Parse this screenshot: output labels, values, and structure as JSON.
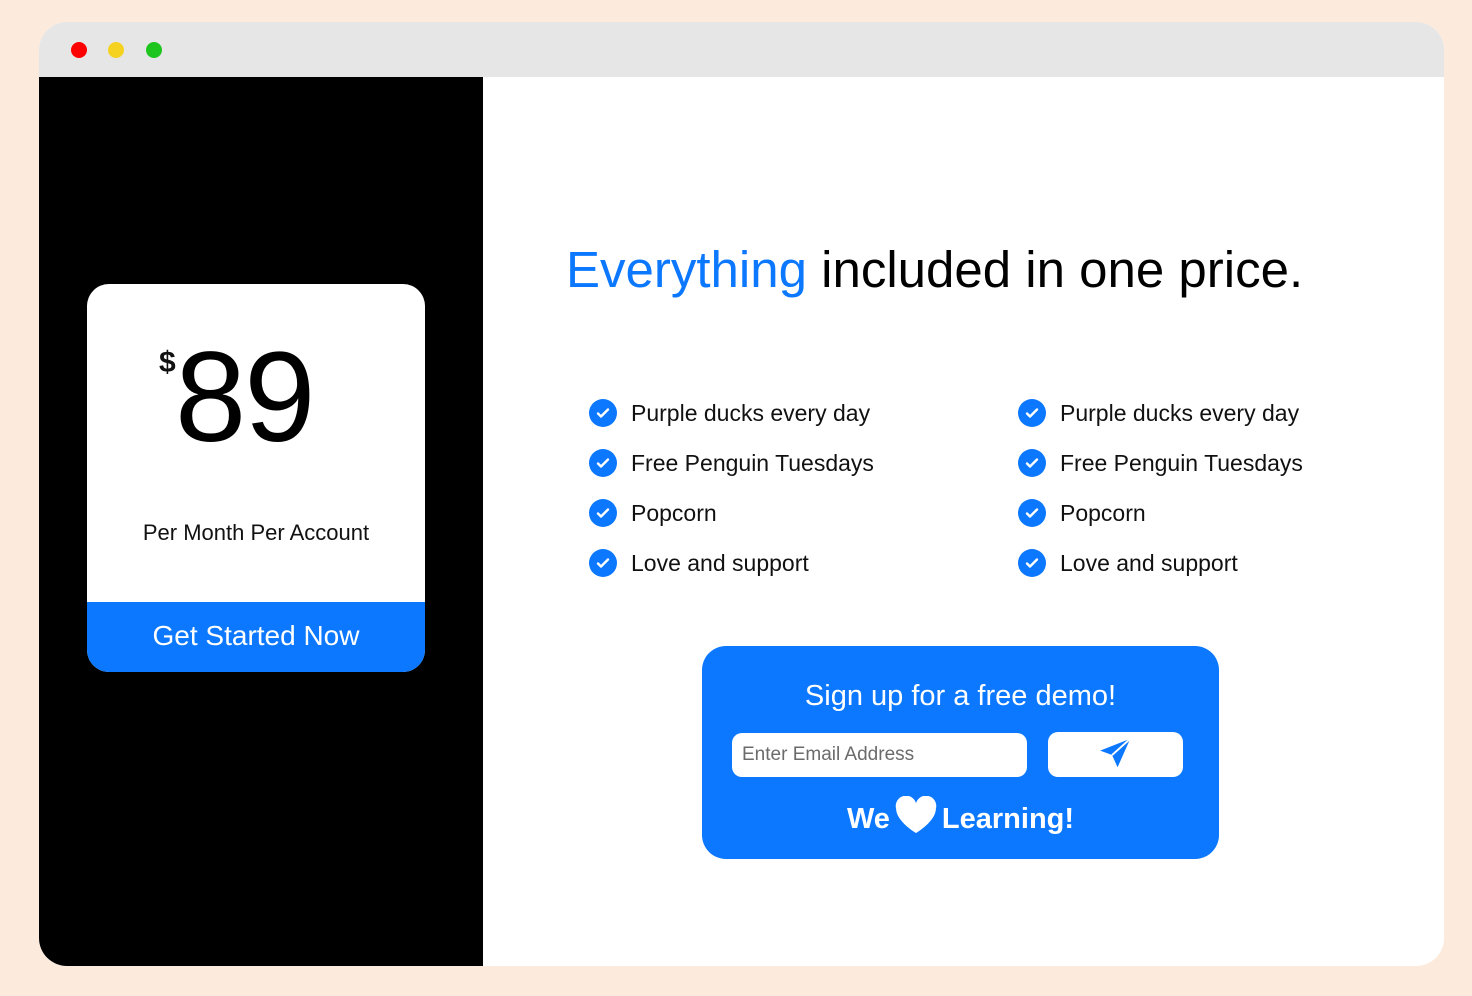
{
  "window": {
    "controls": [
      "close",
      "minimize",
      "maximize"
    ]
  },
  "pricing": {
    "currency": "$",
    "amount": "89",
    "period": "Per Month Per Account",
    "cta_label": "Get Started Now"
  },
  "headline": {
    "accent": "Everything",
    "rest": " included in one price."
  },
  "features": {
    "column1": [
      "Purple ducks every day",
      "Free Penguin Tuesdays",
      "Popcorn",
      "Love and support"
    ],
    "column2": [
      "Purple ducks every day",
      "Free Penguin Tuesdays",
      "Popcorn",
      "Love and support"
    ]
  },
  "signup": {
    "title": "Sign up for a free demo!",
    "email_placeholder": "Enter Email Address",
    "email_value": "",
    "submit_icon": "send-icon",
    "tagline_before": "We",
    "tagline_icon": "heart-icon",
    "tagline_after": "Learning!"
  },
  "colors": {
    "accent": "#0b78ff",
    "page_background": "#fcebdd",
    "sidebar": "#000000",
    "titlebar": "#e6e6e6",
    "close": "#ff0000",
    "minimize": "#f5d21f",
    "maximize": "#1fc51f"
  }
}
